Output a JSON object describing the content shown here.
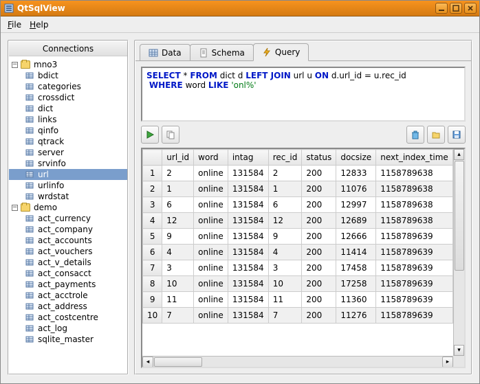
{
  "window": {
    "title": "QtSqlView"
  },
  "menubar": {
    "file": "File",
    "help": "Help"
  },
  "sidebar": {
    "header": "Connections",
    "databases": [
      {
        "name": "mno3",
        "expanded": true,
        "tables": [
          "bdict",
          "categories",
          "crossdict",
          "dict",
          "links",
          "qinfo",
          "qtrack",
          "server",
          "srvinfo",
          "url",
          "urlinfo",
          "wrdstat"
        ],
        "selected_index": 9
      },
      {
        "name": "demo",
        "expanded": true,
        "tables": [
          "act_currency",
          "act_company",
          "act_accounts",
          "act_vouchers",
          "act_v_details",
          "act_consacct",
          "act_payments",
          "act_acctrole",
          "act_address",
          "act_costcentre",
          "act_log",
          "sqlite_master"
        ],
        "selected_index": -1
      }
    ]
  },
  "tabs": {
    "data": "Data",
    "schema": "Schema",
    "query": "Query",
    "active": "query"
  },
  "query_text": {
    "line1_pre": "SELECT",
    "line1_mid1": " * ",
    "line1_kw2": "FROM",
    "line1_mid2": " dict d ",
    "line1_kw3": "LEFT JOIN",
    "line1_mid3": " url u ",
    "line1_kw4": "ON",
    "line1_mid4": " d.url_id = u.rec_id",
    "line2_pre": " ",
    "line2_kw1": "WHERE",
    "line2_mid1": " word ",
    "line2_kw2": "LIKE",
    "line2_mid2": " ",
    "line2_str": "'onl%'"
  },
  "toolbar": {
    "run": "run",
    "copy": "copy",
    "delete": "delete",
    "open": "open",
    "save": "save"
  },
  "grid": {
    "columns": [
      "url_id",
      "word",
      "intag",
      "rec_id",
      "status",
      "docsize",
      "next_index_time"
    ],
    "rows": [
      {
        "n": "1",
        "url_id": "2",
        "word": "online",
        "intag": "131584",
        "rec_id": "2",
        "status": "200",
        "docsize": "12833",
        "next_index_time": "1158789638"
      },
      {
        "n": "2",
        "url_id": "1",
        "word": "online",
        "intag": "131584",
        "rec_id": "1",
        "status": "200",
        "docsize": "11076",
        "next_index_time": "1158789638"
      },
      {
        "n": "3",
        "url_id": "6",
        "word": "online",
        "intag": "131584",
        "rec_id": "6",
        "status": "200",
        "docsize": "12997",
        "next_index_time": "1158789638"
      },
      {
        "n": "4",
        "url_id": "12",
        "word": "online",
        "intag": "131584",
        "rec_id": "12",
        "status": "200",
        "docsize": "12689",
        "next_index_time": "1158789638"
      },
      {
        "n": "5",
        "url_id": "9",
        "word": "online",
        "intag": "131584",
        "rec_id": "9",
        "status": "200",
        "docsize": "12666",
        "next_index_time": "1158789639"
      },
      {
        "n": "6",
        "url_id": "4",
        "word": "online",
        "intag": "131584",
        "rec_id": "4",
        "status": "200",
        "docsize": "11414",
        "next_index_time": "1158789639"
      },
      {
        "n": "7",
        "url_id": "3",
        "word": "online",
        "intag": "131584",
        "rec_id": "3",
        "status": "200",
        "docsize": "17458",
        "next_index_time": "1158789639"
      },
      {
        "n": "8",
        "url_id": "10",
        "word": "online",
        "intag": "131584",
        "rec_id": "10",
        "status": "200",
        "docsize": "17258",
        "next_index_time": "1158789639"
      },
      {
        "n": "9",
        "url_id": "11",
        "word": "online",
        "intag": "131584",
        "rec_id": "11",
        "status": "200",
        "docsize": "11360",
        "next_index_time": "1158789639"
      },
      {
        "n": "10",
        "url_id": "7",
        "word": "online",
        "intag": "131584",
        "rec_id": "7",
        "status": "200",
        "docsize": "11276",
        "next_index_time": "1158789639"
      }
    ]
  }
}
